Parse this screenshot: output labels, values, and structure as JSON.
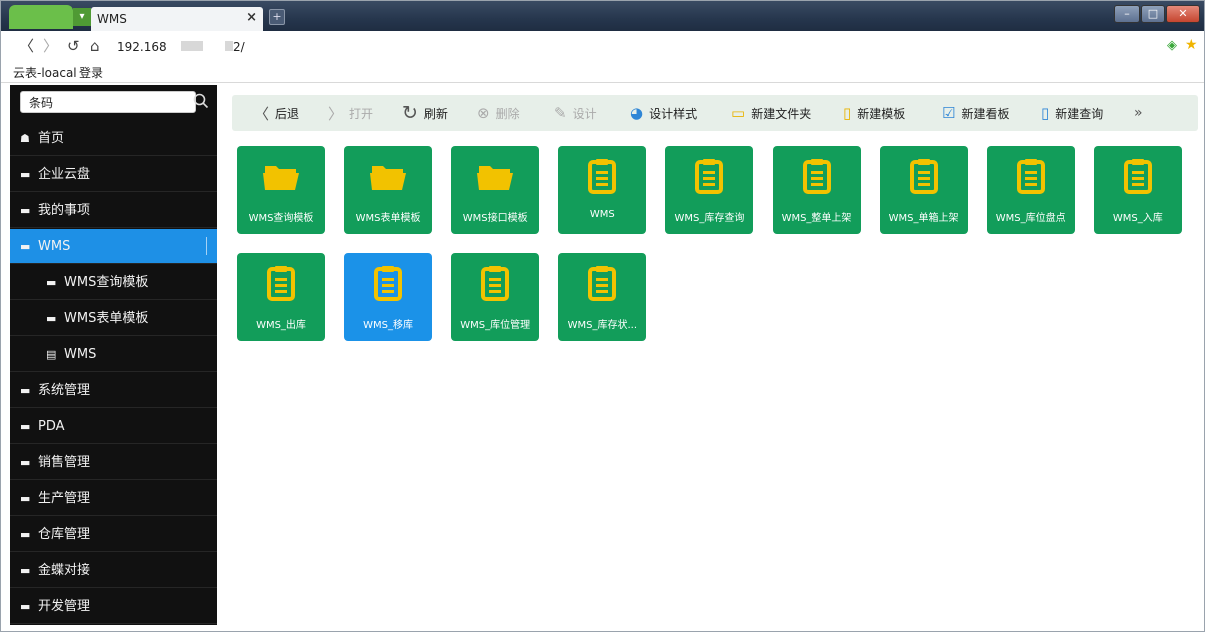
{
  "browser": {
    "tab_title": "WMS",
    "tab_close": "×",
    "new_tab": "+",
    "url_prefix": "192.168",
    "url_suffix": "2/",
    "bookmarks": [
      "云表-loacal",
      "登录"
    ]
  },
  "sidebar": {
    "search_value": "条码",
    "items": [
      {
        "label": "首页",
        "icon": "home-icon",
        "level": 0
      },
      {
        "label": "企业云盘",
        "icon": "folder-icon",
        "level": 0
      },
      {
        "label": "我的事项",
        "icon": "folder-icon",
        "level": 0
      },
      {
        "label": "WMS",
        "icon": "folder-open-icon",
        "level": 0,
        "active": true
      },
      {
        "label": "WMS查询模板",
        "icon": "folder-icon",
        "level": 1
      },
      {
        "label": "WMS表单模板",
        "icon": "folder-icon",
        "level": 1
      },
      {
        "label": "WMS",
        "icon": "clipboard-icon",
        "level": 1
      },
      {
        "label": "系统管理",
        "icon": "folder-icon",
        "level": 0
      },
      {
        "label": "PDA",
        "icon": "folder-icon",
        "level": 0
      },
      {
        "label": "销售管理",
        "icon": "folder-icon",
        "level": 0
      },
      {
        "label": "生产管理",
        "icon": "folder-icon",
        "level": 0
      },
      {
        "label": "仓库管理",
        "icon": "folder-icon",
        "level": 0
      },
      {
        "label": "金蝶对接",
        "icon": "folder-icon",
        "level": 0
      },
      {
        "label": "开发管理",
        "icon": "folder-icon",
        "level": 0
      }
    ]
  },
  "toolbar": {
    "back": "后退",
    "open": "打开",
    "refresh": "刷新",
    "delete": "删除",
    "design": "设计",
    "design_style": "设计样式",
    "new_folder": "新建文件夹",
    "new_template": "新建模板",
    "new_board": "新建看板",
    "new_query": "新建查询",
    "more": "»"
  },
  "tiles": [
    {
      "label": "WMS查询模板",
      "type": "folder"
    },
    {
      "label": "WMS表单模板",
      "type": "folder"
    },
    {
      "label": "WMS接口模板",
      "type": "folder"
    },
    {
      "label": "WMS",
      "type": "clipboard"
    },
    {
      "label": "WMS_库存查询",
      "type": "clipboard"
    },
    {
      "label": "WMS_整单上架",
      "type": "clipboard"
    },
    {
      "label": "WMS_单箱上架",
      "type": "clipboard"
    },
    {
      "label": "WMS_库位盘点",
      "type": "clipboard"
    },
    {
      "label": "WMS_入库",
      "type": "clipboard"
    },
    {
      "label": "WMS_出库",
      "type": "clipboard"
    },
    {
      "label": "WMS_移库",
      "type": "clipboard",
      "selected": true
    },
    {
      "label": "WMS_库位管理",
      "type": "clipboard"
    },
    {
      "label": "WMS_库存状...",
      "type": "clipboard"
    }
  ],
  "colors": {
    "tile_green": "#129d5a",
    "tile_selected": "#1b92e8",
    "sidebar_active": "#1e90e6",
    "icon_yellow": "#f2c200"
  }
}
